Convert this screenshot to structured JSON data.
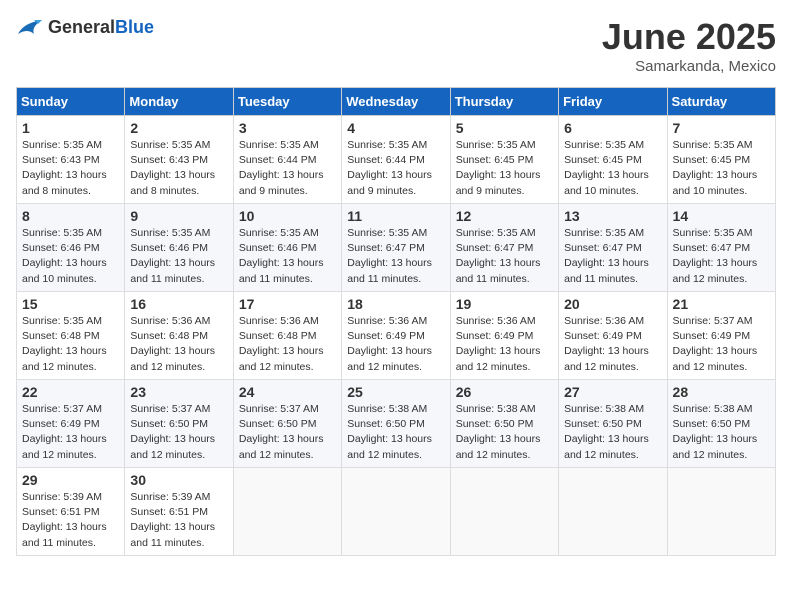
{
  "header": {
    "logo_general": "General",
    "logo_blue": "Blue",
    "month_title": "June 2025",
    "location": "Samarkanda, Mexico"
  },
  "days_of_week": [
    "Sunday",
    "Monday",
    "Tuesday",
    "Wednesday",
    "Thursday",
    "Friday",
    "Saturday"
  ],
  "weeks": [
    [
      {
        "day": "1",
        "sunrise": "5:35 AM",
        "sunset": "6:43 PM",
        "daylight": "13 hours and 8 minutes."
      },
      {
        "day": "2",
        "sunrise": "5:35 AM",
        "sunset": "6:43 PM",
        "daylight": "13 hours and 8 minutes."
      },
      {
        "day": "3",
        "sunrise": "5:35 AM",
        "sunset": "6:44 PM",
        "daylight": "13 hours and 9 minutes."
      },
      {
        "day": "4",
        "sunrise": "5:35 AM",
        "sunset": "6:44 PM",
        "daylight": "13 hours and 9 minutes."
      },
      {
        "day": "5",
        "sunrise": "5:35 AM",
        "sunset": "6:45 PM",
        "daylight": "13 hours and 9 minutes."
      },
      {
        "day": "6",
        "sunrise": "5:35 AM",
        "sunset": "6:45 PM",
        "daylight": "13 hours and 10 minutes."
      },
      {
        "day": "7",
        "sunrise": "5:35 AM",
        "sunset": "6:45 PM",
        "daylight": "13 hours and 10 minutes."
      }
    ],
    [
      {
        "day": "8",
        "sunrise": "5:35 AM",
        "sunset": "6:46 PM",
        "daylight": "13 hours and 10 minutes."
      },
      {
        "day": "9",
        "sunrise": "5:35 AM",
        "sunset": "6:46 PM",
        "daylight": "13 hours and 11 minutes."
      },
      {
        "day": "10",
        "sunrise": "5:35 AM",
        "sunset": "6:46 PM",
        "daylight": "13 hours and 11 minutes."
      },
      {
        "day": "11",
        "sunrise": "5:35 AM",
        "sunset": "6:47 PM",
        "daylight": "13 hours and 11 minutes."
      },
      {
        "day": "12",
        "sunrise": "5:35 AM",
        "sunset": "6:47 PM",
        "daylight": "13 hours and 11 minutes."
      },
      {
        "day": "13",
        "sunrise": "5:35 AM",
        "sunset": "6:47 PM",
        "daylight": "13 hours and 11 minutes."
      },
      {
        "day": "14",
        "sunrise": "5:35 AM",
        "sunset": "6:47 PM",
        "daylight": "13 hours and 12 minutes."
      }
    ],
    [
      {
        "day": "15",
        "sunrise": "5:35 AM",
        "sunset": "6:48 PM",
        "daylight": "13 hours and 12 minutes."
      },
      {
        "day": "16",
        "sunrise": "5:36 AM",
        "sunset": "6:48 PM",
        "daylight": "13 hours and 12 minutes."
      },
      {
        "day": "17",
        "sunrise": "5:36 AM",
        "sunset": "6:48 PM",
        "daylight": "13 hours and 12 minutes."
      },
      {
        "day": "18",
        "sunrise": "5:36 AM",
        "sunset": "6:49 PM",
        "daylight": "13 hours and 12 minutes."
      },
      {
        "day": "19",
        "sunrise": "5:36 AM",
        "sunset": "6:49 PM",
        "daylight": "13 hours and 12 minutes."
      },
      {
        "day": "20",
        "sunrise": "5:36 AM",
        "sunset": "6:49 PM",
        "daylight": "13 hours and 12 minutes."
      },
      {
        "day": "21",
        "sunrise": "5:37 AM",
        "sunset": "6:49 PM",
        "daylight": "13 hours and 12 minutes."
      }
    ],
    [
      {
        "day": "22",
        "sunrise": "5:37 AM",
        "sunset": "6:49 PM",
        "daylight": "13 hours and 12 minutes."
      },
      {
        "day": "23",
        "sunrise": "5:37 AM",
        "sunset": "6:50 PM",
        "daylight": "13 hours and 12 minutes."
      },
      {
        "day": "24",
        "sunrise": "5:37 AM",
        "sunset": "6:50 PM",
        "daylight": "13 hours and 12 minutes."
      },
      {
        "day": "25",
        "sunrise": "5:38 AM",
        "sunset": "6:50 PM",
        "daylight": "13 hours and 12 minutes."
      },
      {
        "day": "26",
        "sunrise": "5:38 AM",
        "sunset": "6:50 PM",
        "daylight": "13 hours and 12 minutes."
      },
      {
        "day": "27",
        "sunrise": "5:38 AM",
        "sunset": "6:50 PM",
        "daylight": "13 hours and 12 minutes."
      },
      {
        "day": "28",
        "sunrise": "5:38 AM",
        "sunset": "6:50 PM",
        "daylight": "13 hours and 12 minutes."
      }
    ],
    [
      {
        "day": "29",
        "sunrise": "5:39 AM",
        "sunset": "6:51 PM",
        "daylight": "13 hours and 11 minutes."
      },
      {
        "day": "30",
        "sunrise": "5:39 AM",
        "sunset": "6:51 PM",
        "daylight": "13 hours and 11 minutes."
      },
      null,
      null,
      null,
      null,
      null
    ]
  ]
}
